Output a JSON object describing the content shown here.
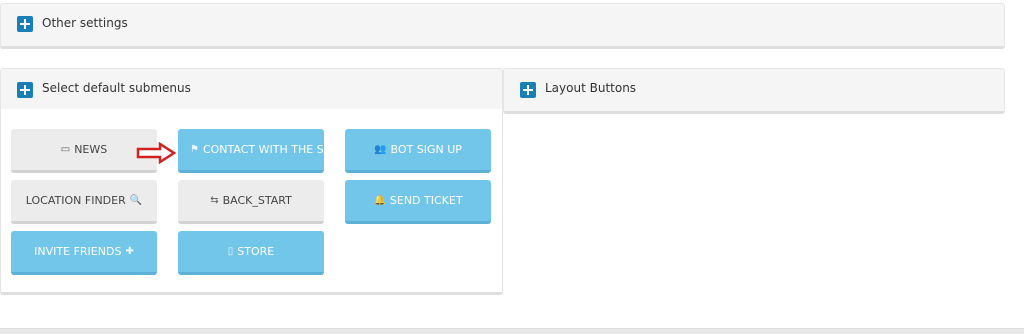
{
  "panels": {
    "other_settings": {
      "title": "Other settings"
    },
    "default_submenus": {
      "title": "Select default submenus"
    },
    "layout_buttons": {
      "title": "Layout Buttons"
    }
  },
  "submenu_buttons": [
    {
      "label": "NEWS",
      "icon": "newspaper-icon",
      "glyph": "▭",
      "icon_position": "before",
      "style": "gray"
    },
    {
      "label": "CONTACT WITH THE SU",
      "icon": "flag-icon",
      "glyph": "⚑",
      "icon_position": "before",
      "style": "blue"
    },
    {
      "label": "BOT SIGN UP",
      "icon": "users-icon",
      "glyph": "👥",
      "icon_position": "before",
      "style": "blue"
    },
    {
      "label": "LOCATION FINDER",
      "icon": "search-icon",
      "glyph": "🔍",
      "icon_position": "after",
      "style": "gray"
    },
    {
      "label": "BACK_START",
      "icon": "sliders-icon",
      "glyph": "⇆",
      "icon_position": "before",
      "style": "gray"
    },
    {
      "label": "SEND TICKET",
      "icon": "bell-icon",
      "glyph": "🔔",
      "icon_position": "before",
      "style": "blue"
    },
    {
      "label": "INVITE FRIENDS",
      "icon": "plus-icon",
      "glyph": "✚",
      "icon_position": "after",
      "style": "blue"
    },
    {
      "label": "STORE",
      "icon": "square-icon",
      "glyph": "▯",
      "icon_position": "before",
      "style": "blue"
    }
  ],
  "colors": {
    "accent_blue": "#72c6ea",
    "plus_icon": "#1a7fb5",
    "arrow_red": "#d32020"
  }
}
